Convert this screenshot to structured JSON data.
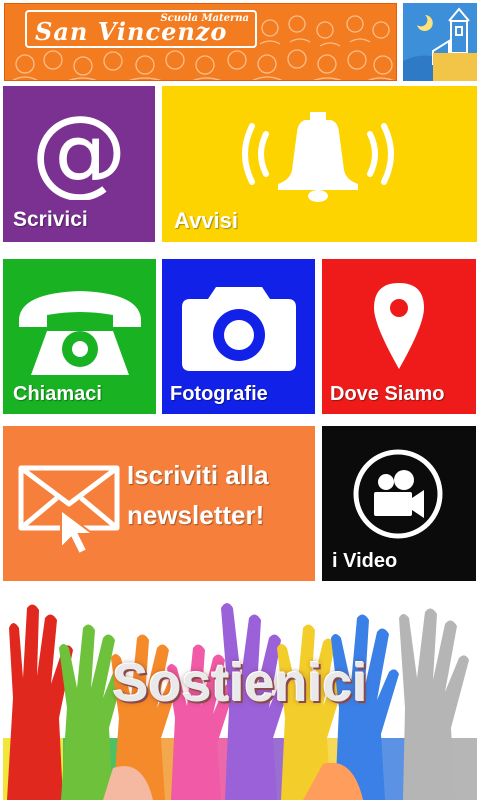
{
  "header": {
    "school_type": "Scuola Materna",
    "school_name": "San Vincenzo"
  },
  "tiles": {
    "scrivici": {
      "label": "Scrivici",
      "color": "#7a3192",
      "icon": "at-sign-icon"
    },
    "avvisi": {
      "label": "Avvisi",
      "color": "#fdd400",
      "icon": "bell-ringing-icon"
    },
    "chiamaci": {
      "label": "Chiamaci",
      "color": "#19b223",
      "icon": "telephone-icon"
    },
    "fotografie": {
      "label": "Fotografie",
      "color": "#1221e8",
      "icon": "camera-icon"
    },
    "dove_siamo": {
      "label": "Dove Siamo",
      "color": "#ef1b1b",
      "icon": "map-pin-icon"
    },
    "newsletter": {
      "label_line1": "Iscriviti alla",
      "label_line2": "newsletter!",
      "color": "#f67f3b",
      "icon": "envelope-cursor-icon"
    },
    "video": {
      "label": "i Video",
      "color": "#0b0b0b",
      "icon": "video-camera-icon"
    },
    "sostienici": {
      "label": "Sostienici",
      "icon": "raised-hands-illustration"
    }
  }
}
